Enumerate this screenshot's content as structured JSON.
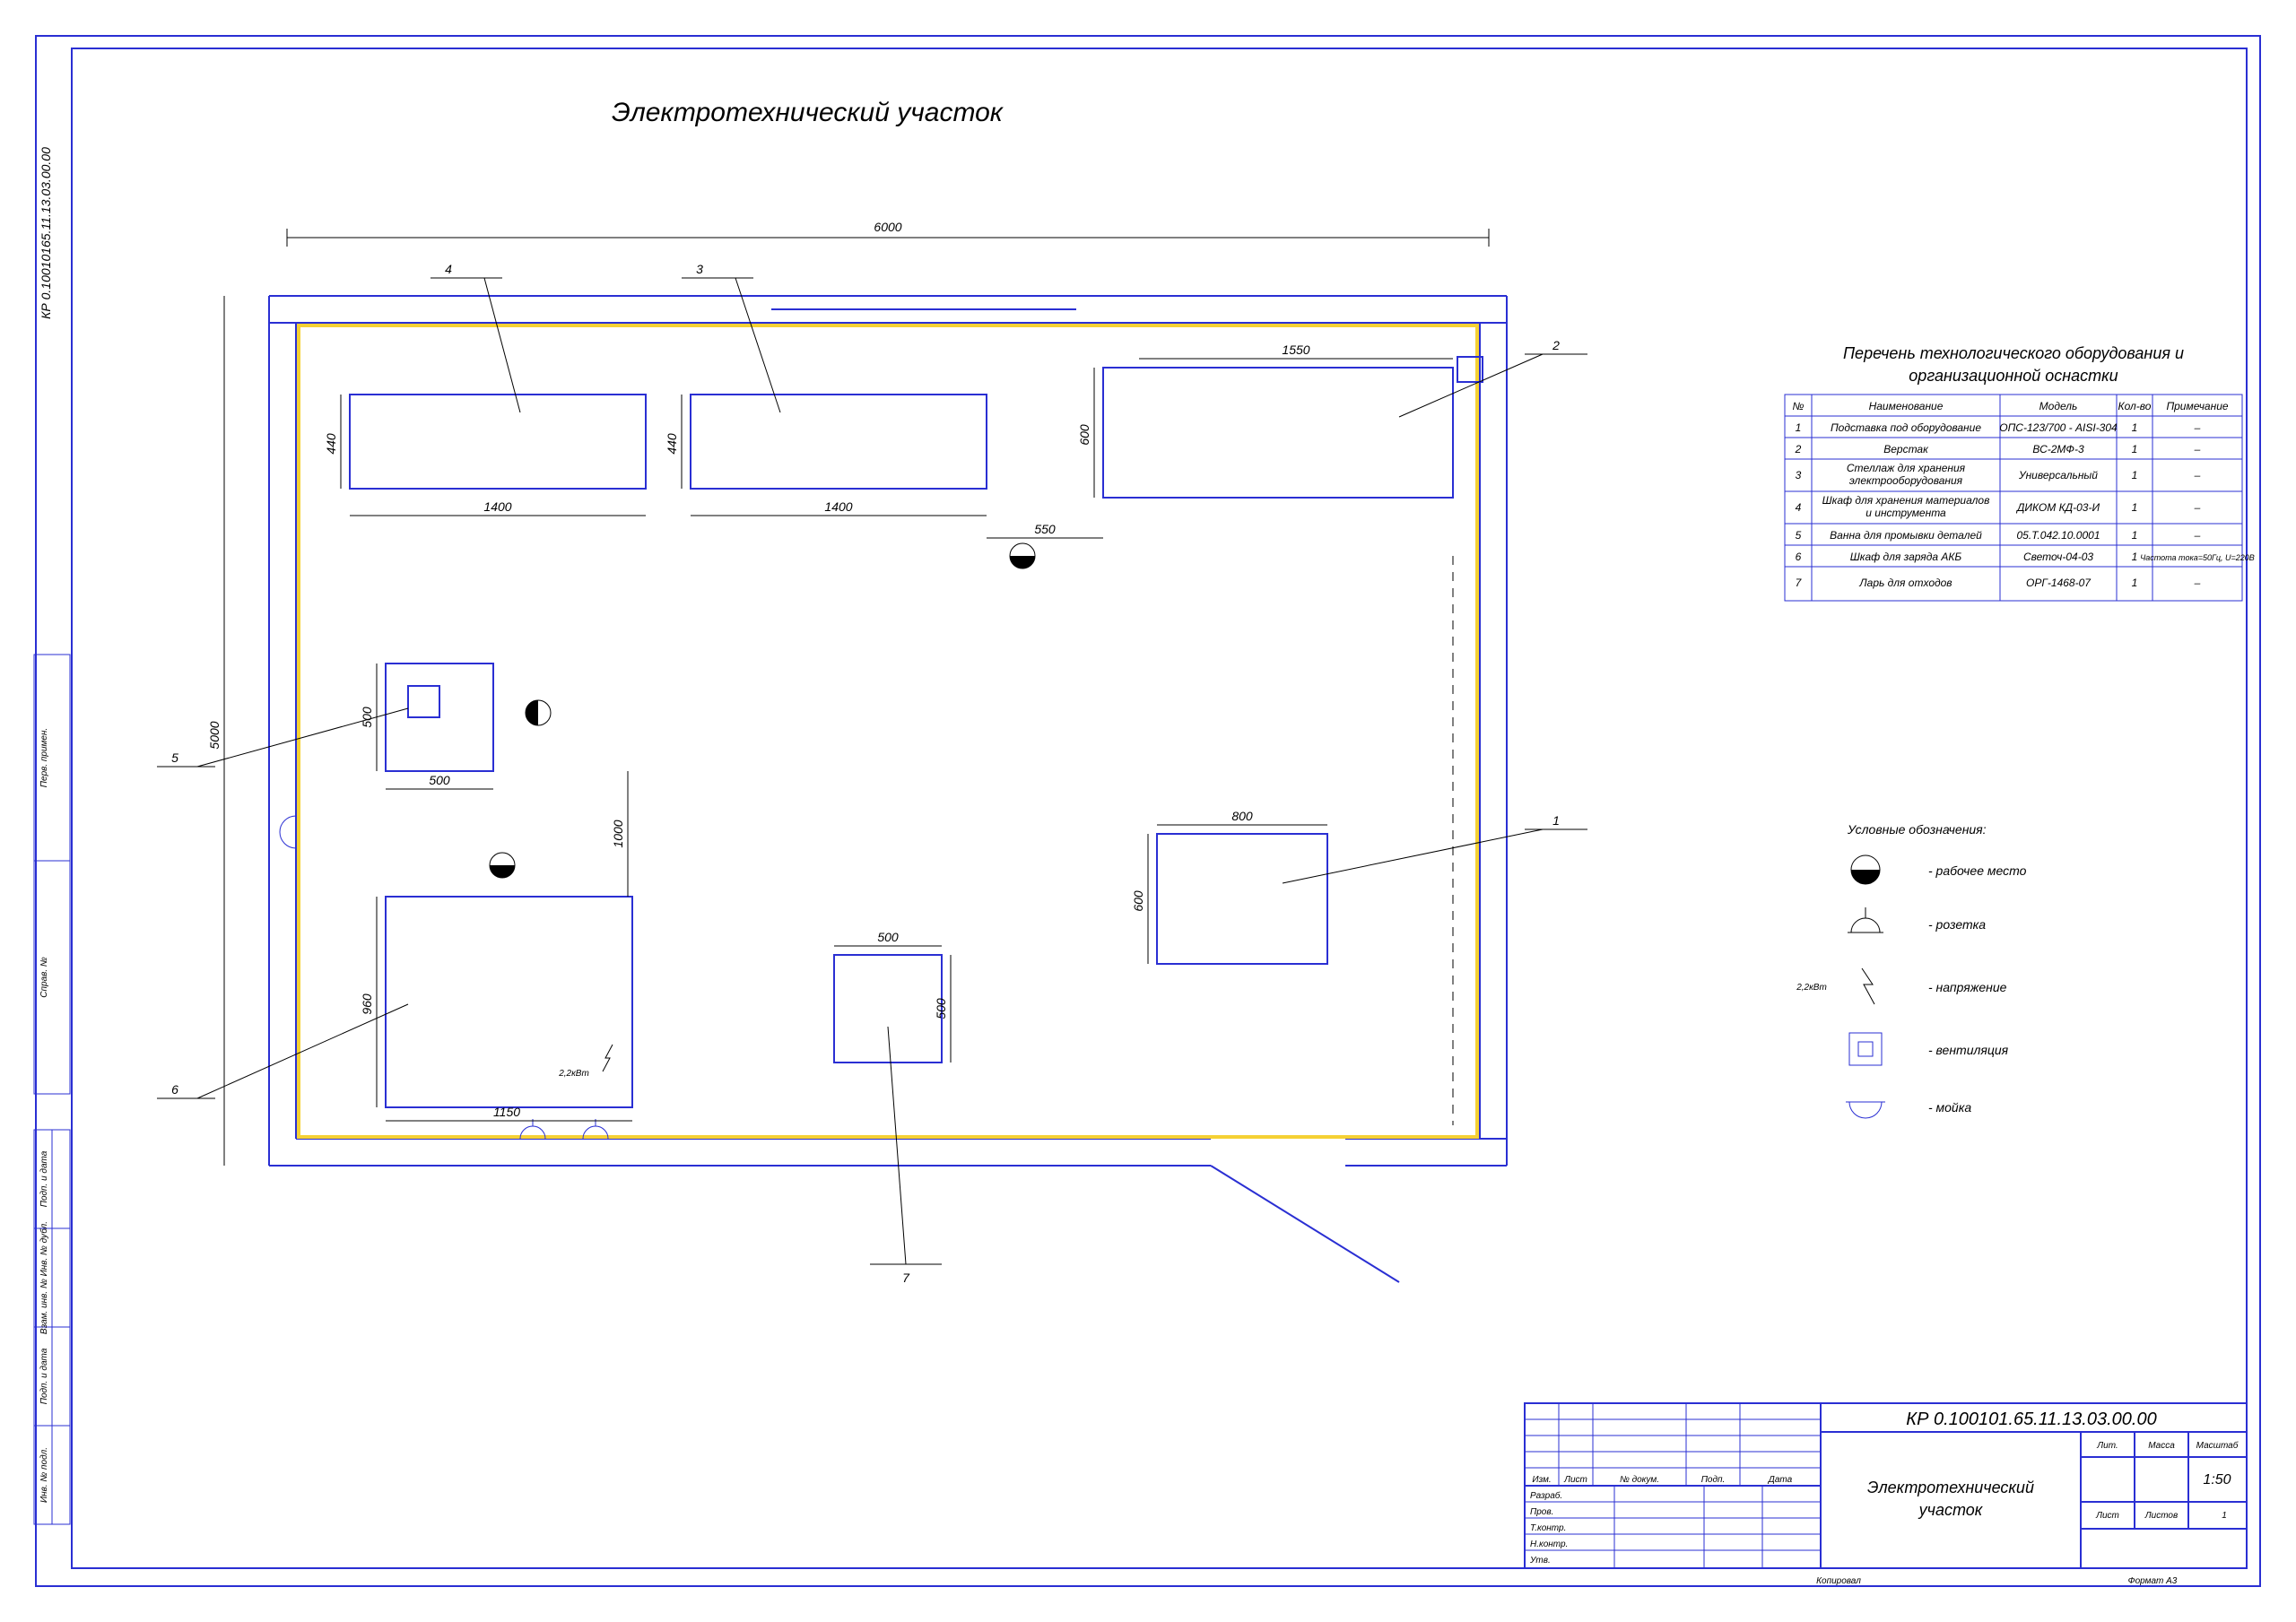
{
  "title": "Электротехнический участок",
  "frame_code": "КР 0.10010165.11.13.03.00.00",
  "dims": {
    "overall_w": "6000",
    "overall_h": "5000",
    "d1400a": "1400",
    "d1400b": "1400",
    "d440a": "440",
    "d440b": "440",
    "d600a": "600",
    "d600b": "600",
    "d550": "550",
    "d1550": "1550",
    "d500a": "500",
    "d500b": "500",
    "d500c": "500",
    "d500d": "500",
    "d1000": "1000",
    "d960": "960",
    "d1150": "1150",
    "d800": "800",
    "power": "2,2кВт"
  },
  "callouts": {
    "c1": "1",
    "c2": "2",
    "c3": "3",
    "c4": "4",
    "c5": "5",
    "c6": "6",
    "c7": "7"
  },
  "table": {
    "title": "Перечень технологического оборудования и\nорганизационной оснастки",
    "headers": {
      "n": "№",
      "name": "Наименование",
      "model": "Модель",
      "qty": "Кол-во",
      "note": "Примечание"
    },
    "rows": [
      {
        "n": "1",
        "name": "Подставка под оборудование",
        "model": "ОПС-123/700 - AISI-304",
        "qty": "1",
        "note": "–"
      },
      {
        "n": "2",
        "name": "Верстак",
        "model": "ВС-2МФ-3",
        "qty": "1",
        "note": "–"
      },
      {
        "n": "3",
        "name": "Стеллаж для хранения\nэлектрооборудования",
        "model": "Универсальный",
        "qty": "1",
        "note": "–"
      },
      {
        "n": "4",
        "name": "Шкаф для хранения материалов\nи инструмента",
        "model": "ДИКОМ КД-03-И",
        "qty": "1",
        "note": "–"
      },
      {
        "n": "5",
        "name": "Ванна для промывки деталей",
        "model": "05.Т.042.10.0001",
        "qty": "1",
        "note": "–"
      },
      {
        "n": "6",
        "name": "Шкаф для заряда АКБ",
        "model": "Светоч-04-03",
        "qty": "1",
        "note": "Частота тока=50Гц, U=220В"
      },
      {
        "n": "7",
        "name": "Ларь для отходов",
        "model": "ОРГ-1468-07",
        "qty": "1",
        "note": "–"
      }
    ]
  },
  "legend": {
    "title": "Условные обозначения:",
    "workplace": "- рабочее место",
    "socket": "- розетка",
    "voltage": "- напряжение",
    "vent": "- вентиляция",
    "wash": "- мойка",
    "pw": "2,2кВт"
  },
  "titleblock": {
    "code": "КР 0.100101.65.11.13.03.00.00",
    "name": "Электротехнический\nучасток",
    "scale": "1:50",
    "lit": "Лит.",
    "mass": "Масса",
    "masht": "Масштаб",
    "list": "Лист",
    "listov": "Листов",
    "n1": "1",
    "r1": "Изм.",
    "r2": "Лист",
    "r3": "№ докум.",
    "r4": "Подп.",
    "r5": "Дата",
    "rows": [
      "Разраб.",
      "Пров.",
      "Т.контр.",
      "Н.контр.",
      "Утв."
    ],
    "footer_l": "Копировал",
    "footer_r": "Формат   A3",
    "side": [
      "Инв. № подл.",
      "Подп. и дата",
      "Взам. инв. № Инв. № дубл.",
      "Подп. и дата",
      "Справ. №",
      "Перв. примен."
    ]
  }
}
